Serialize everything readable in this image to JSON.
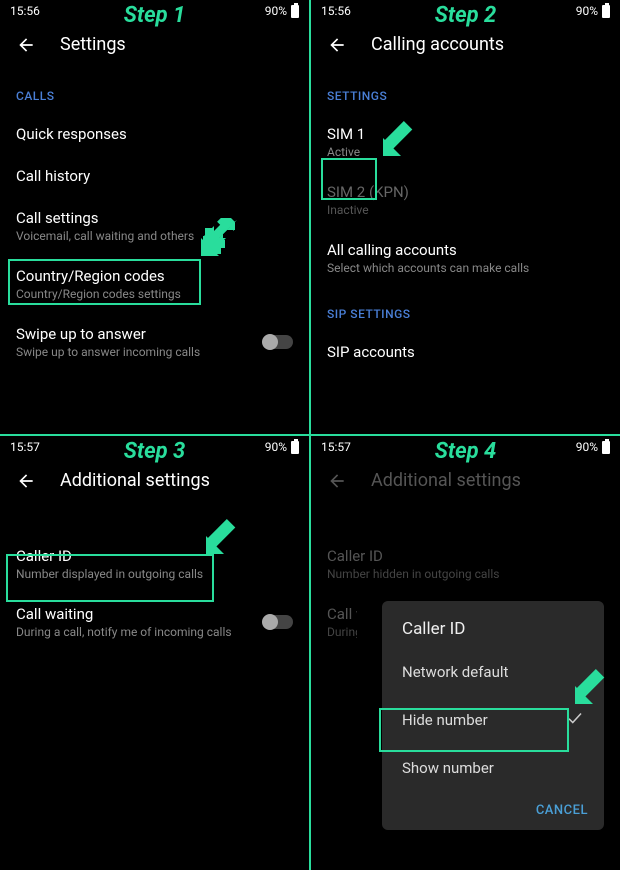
{
  "step1": {
    "label": "Step 1",
    "time": "15:56",
    "battery": "90%",
    "title": "Settings",
    "section_calls": "CALLS",
    "items": {
      "quick_responses": "Quick responses",
      "call_history": "Call history",
      "call_settings": {
        "title": "Call settings",
        "sub": "Voicemail, call waiting and others"
      },
      "country_codes": {
        "title": "Country/Region codes",
        "sub": "Country/Region codes settings"
      },
      "swipe_up": {
        "title": "Swipe up to answer",
        "sub": "Swipe up to answer incoming calls"
      }
    }
  },
  "step2": {
    "label": "Step 2",
    "time": "15:56",
    "battery": "90%",
    "title": "Calling accounts",
    "section_settings": "SETTINGS",
    "sim1": {
      "title": "SIM 1",
      "sub": "Active"
    },
    "sim2": {
      "title": "SIM 2  (KPN)",
      "sub": "Inactive"
    },
    "all_accounts": {
      "title": "All calling accounts",
      "sub": "Select which accounts can make calls"
    },
    "section_sip": "SIP SETTINGS",
    "sip_accounts": "SIP accounts"
  },
  "step3": {
    "label": "Step 3",
    "time": "15:57",
    "battery": "90%",
    "title": "Additional settings",
    "caller_id": {
      "title": "Caller ID",
      "sub": "Number displayed in outgoing calls"
    },
    "call_waiting": {
      "title": "Call waiting",
      "sub": "During a call, notify me of incoming calls"
    }
  },
  "step4": {
    "label": "Step 4",
    "time": "15:57",
    "battery": "90%",
    "title": "Additional settings",
    "caller_id_bg": {
      "title": "Caller ID",
      "sub": "Number hidden in outgoing calls"
    },
    "call_waiting_bg": {
      "title": "Call waiting",
      "sub": "During a call, notify me of incoming calls"
    },
    "dialog": {
      "title": "Caller ID",
      "opt_default": "Network default",
      "opt_hide": "Hide number",
      "opt_show": "Show number",
      "cancel": "CANCEL"
    }
  }
}
